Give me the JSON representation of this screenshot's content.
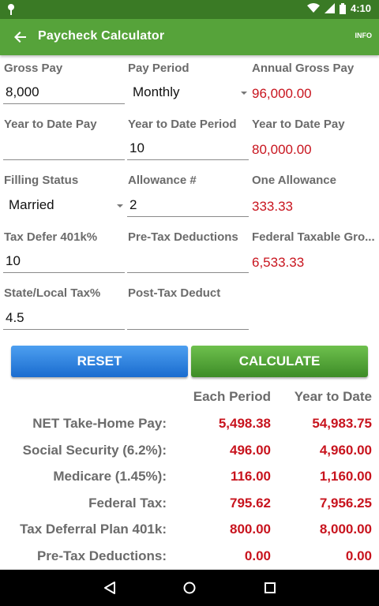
{
  "status_bar": {
    "time": "4:10",
    "icons": [
      "notification-pin-icon",
      "wifi-icon",
      "signal-icon",
      "battery-icon"
    ]
  },
  "app_bar": {
    "title": "Paycheck Calculator",
    "info_label": "INFO"
  },
  "form": {
    "gross_pay": {
      "label": "Gross Pay",
      "value": "8,000"
    },
    "pay_period": {
      "label": "Pay Period",
      "value": "Monthly"
    },
    "annual_gross_pay": {
      "label": "Annual Gross Pay",
      "value": "96,000.00"
    },
    "ytd_pay_input": {
      "label": "Year to Date Pay",
      "value": ""
    },
    "ytd_period": {
      "label": "Year to Date Period",
      "value": "10"
    },
    "ytd_pay_result": {
      "label": "Year to Date Pay",
      "value": "80,000.00"
    },
    "filing_status": {
      "label": "Filling Status",
      "value": "Married"
    },
    "allowance_count": {
      "label": "Allowance #",
      "value": "2"
    },
    "one_allowance": {
      "label": "One Allowance",
      "value": "333.33"
    },
    "tax_defer_401k": {
      "label": "Tax Defer 401k%",
      "value": "10"
    },
    "pre_tax_deductions": {
      "label": "Pre-Tax Deductions",
      "value": ""
    },
    "federal_taxable_gross": {
      "label": "Federal Taxable Gro...",
      "value": "6,533.33"
    },
    "state_local_tax": {
      "label": "State/Local Tax%",
      "value": "4.5"
    },
    "post_tax_deduct": {
      "label": "Post-Tax Deduct",
      "value": ""
    }
  },
  "buttons": {
    "reset": "RESET",
    "calculate": "CALCULATE"
  },
  "results": {
    "headers": {
      "each_period": "Each Period",
      "year_to_date": "Year to Date"
    },
    "rows": [
      {
        "label": "NET Take-Home Pay:",
        "each": "5,498.38",
        "ytd": "54,983.75"
      },
      {
        "label": "Social Security (6.2%):",
        "each": "496.00",
        "ytd": "4,960.00"
      },
      {
        "label": "Medicare (1.45%):",
        "each": "116.00",
        "ytd": "1,160.00"
      },
      {
        "label": "Federal Tax:",
        "each": "795.62",
        "ytd": "7,956.25"
      },
      {
        "label": "Tax Deferral Plan 401k:",
        "each": "800.00",
        "ytd": "8,000.00"
      },
      {
        "label": "Pre-Tax Deductions:",
        "each": "0.00",
        "ytd": "0.00"
      }
    ]
  },
  "colors": {
    "app_bar": "#56a33a",
    "status_bar": "#3a7a25",
    "accent_red": "#c8141e",
    "reset_blue": "#1a6ccf",
    "calc_green": "#3d8c27"
  }
}
